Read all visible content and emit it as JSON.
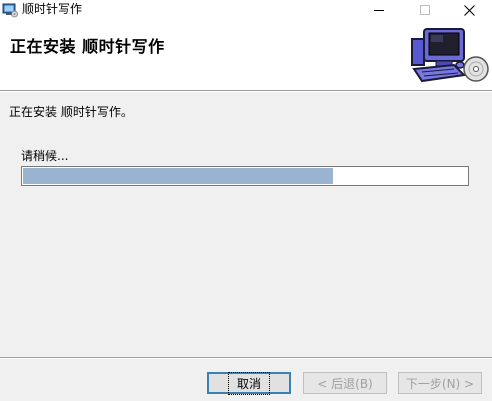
{
  "window": {
    "title": "顺时针写作",
    "icons": {
      "app": "installer-icon",
      "minimize": "minimize-icon",
      "maximize": "maximize-icon",
      "close": "close-icon"
    }
  },
  "header": {
    "title": "正在安装 顺时针写作",
    "graphic": "computer-install-icon"
  },
  "main": {
    "status": "正在安装 顺时针写作。",
    "progress_label": "请稍候...",
    "progress_fraction": 0.699
  },
  "buttons": {
    "cancel": "取消",
    "back": "< 后退(B)",
    "next": "下一步(N) >"
  },
  "colors": {
    "progress_fill": "#99b4d1",
    "background": "#f0f0f0",
    "focus_border": "#3c7fb1"
  }
}
